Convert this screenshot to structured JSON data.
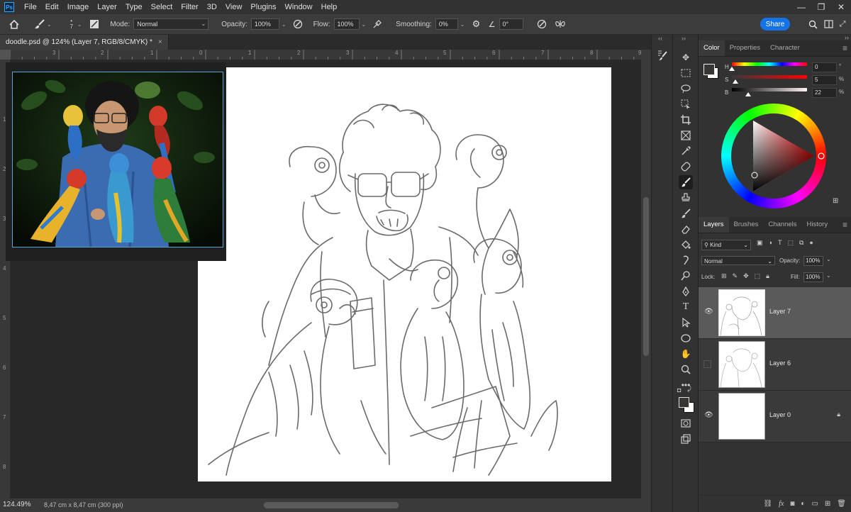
{
  "app": {
    "logo": "Ps"
  },
  "menu": [
    "File",
    "Edit",
    "Image",
    "Layer",
    "Type",
    "Select",
    "Filter",
    "3D",
    "View",
    "Plugins",
    "Window",
    "Help"
  ],
  "window_controls": [
    "—",
    "❐",
    "✕"
  ],
  "options_bar": {
    "mode_label": "Mode:",
    "mode_value": "Normal",
    "opacity_label": "Opacity:",
    "opacity_value": "100%",
    "flow_label": "Flow:",
    "flow_value": "100%",
    "smoothing_label": "Smoothing:",
    "smoothing_value": "0%",
    "angle_value": "0°",
    "brush_size": "7",
    "share_label": "Share"
  },
  "document": {
    "tab_title": "doodle.psd @ 124% (Layer 7, RGB/8/CMYK) *",
    "close": "×",
    "zoom": "124.49%",
    "size_info": "8,47 cm x 8,47 cm (300 ppi)"
  },
  "rulers": {
    "top": [
      "3",
      "2",
      "1",
      "0",
      "1",
      "2",
      "3",
      "4",
      "5",
      "6",
      "7",
      "8",
      "9"
    ],
    "left": [
      "1",
      "2",
      "3",
      "4",
      "5",
      "6",
      "7",
      "8"
    ]
  },
  "color_panel": {
    "tabs": [
      "Color",
      "Properties",
      "Character"
    ],
    "h_label": "H",
    "h_value": "0",
    "h_unit": "°",
    "s_label": "S",
    "s_value": "5",
    "s_unit": "%",
    "b_label": "B",
    "b_value": "22",
    "b_unit": "%",
    "h_pos": 0.0,
    "s_pos": 0.05,
    "b_pos": 0.22,
    "foreground": "#383535",
    "background": "#ffffff"
  },
  "layers_panel": {
    "tabs": [
      "Layers",
      "Brushes",
      "Channels",
      "History"
    ],
    "filter_kind": "Kind",
    "blend_mode": "Normal",
    "opacity_label": "Opacity:",
    "opacity_value": "100%",
    "lock_label": "Lock:",
    "fill_label": "Fill:",
    "fill_value": "100%",
    "layers": [
      {
        "name": "Layer 7",
        "visible": true,
        "selected": true
      },
      {
        "name": "Layer 6",
        "visible": false,
        "selected": false
      },
      {
        "name": "Layer 0",
        "visible": true,
        "selected": false,
        "locked": true
      }
    ]
  },
  "colors": {
    "accent": "#1473e6",
    "panel_bg": "#323232",
    "canvas_bg": "#282828"
  }
}
